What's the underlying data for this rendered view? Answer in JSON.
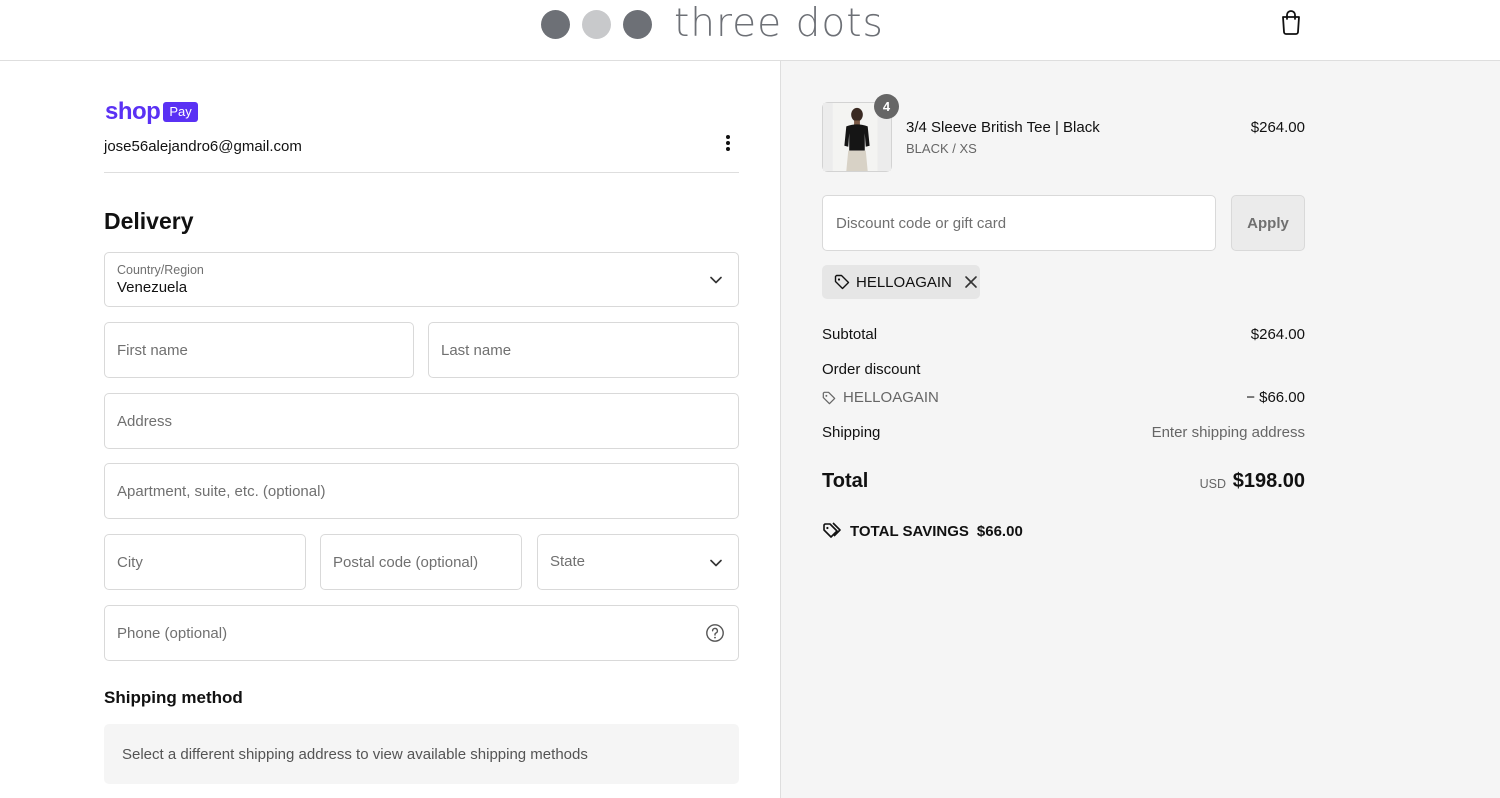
{
  "header": {
    "brand": "three dots",
    "dot_colors": [
      "#6d7076",
      "#c8c9cb",
      "#6d7076"
    ]
  },
  "express": {
    "shop_label": "shop",
    "pay_label": "Pay",
    "email": "jose56alejandro6@gmail.com"
  },
  "delivery": {
    "title": "Delivery",
    "country_label": "Country/Region",
    "country_value": "Venezuela",
    "first_name_placeholder": "First name",
    "last_name_placeholder": "Last name",
    "address_placeholder": "Address",
    "apartment_placeholder": "Apartment, suite, etc. (optional)",
    "city_placeholder": "City",
    "postal_placeholder": "Postal code (optional)",
    "state_placeholder": "State",
    "phone_placeholder": "Phone (optional)"
  },
  "shipping_method": {
    "title": "Shipping method",
    "message": "Select a different shipping address to view available shipping methods"
  },
  "summary": {
    "product": {
      "quantity": "4",
      "title": "3/4 Sleeve British Tee | Black",
      "variant": "BLACK / XS",
      "price": "$264.00"
    },
    "discount_placeholder": "Discount code or gift card",
    "apply_label": "Apply",
    "applied_code": "HELLOAGAIN",
    "subtotal_label": "Subtotal",
    "subtotal_value": "$264.00",
    "order_discount_label": "Order discount",
    "discount_code": "HELLOAGAIN",
    "discount_value": "− $66.00",
    "shipping_label": "Shipping",
    "shipping_value": "Enter shipping address",
    "total_label": "Total",
    "total_currency": "USD",
    "total_value": "$198.00",
    "savings_label": "TOTAL SAVINGS",
    "savings_value": "$66.00"
  }
}
